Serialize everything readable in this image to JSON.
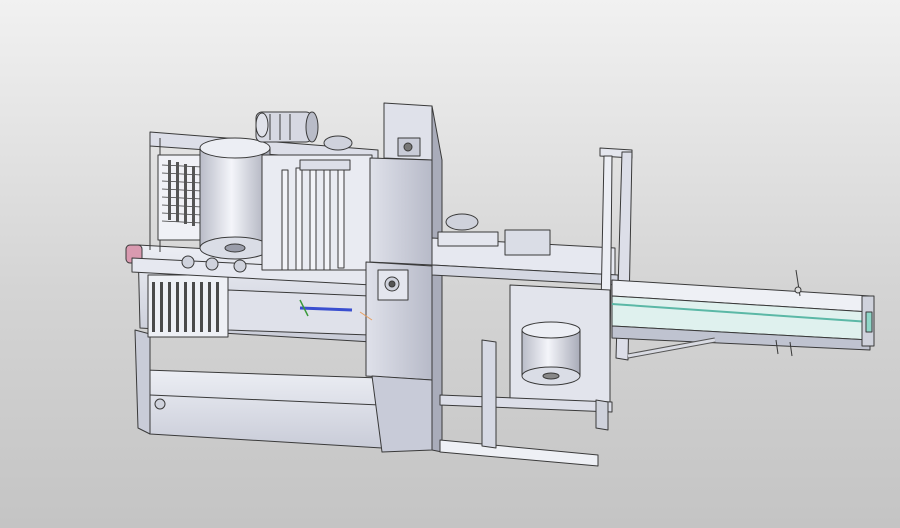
{
  "viewport": {
    "background_top": "#f1f1f1",
    "background_bottom": "#c4c4c4"
  },
  "model": {
    "part_color": "#e4e6ee",
    "part_shadow": "#b8bcca",
    "edge_color": "#3a3a3a",
    "roller_color": "#c9ccd6",
    "pink_knob_color": "#d99ab0",
    "teal_belt_color": "#8fd6c8",
    "blue_rod_color": "#3a4fd0"
  }
}
